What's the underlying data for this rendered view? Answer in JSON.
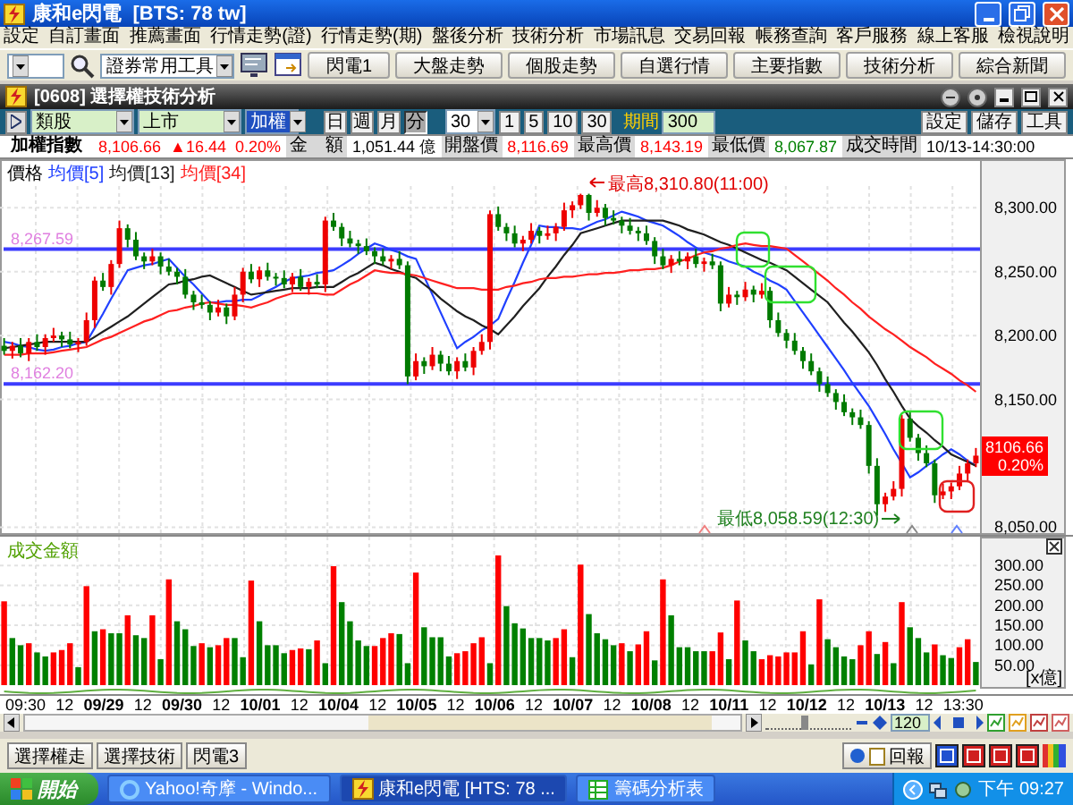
{
  "window": {
    "title": "康和e閃電  [BTS: 78 tw]"
  },
  "menu": [
    "設定",
    "自訂畫面",
    "推薦畫面",
    "行情走勢(證)",
    "行情走勢(期)",
    "盤後分析",
    "技術分析",
    "市場訊息",
    "交易回報",
    "帳務查詢",
    "客戶服務",
    "線上客服",
    "檢視說明"
  ],
  "toolbar": {
    "tool_select": "證券常用工具",
    "buttons": [
      "閃電1",
      "大盤走勢",
      "個股走勢",
      "自選行情",
      "主要指數",
      "技術分析",
      "綜合新聞"
    ]
  },
  "subwindow": {
    "title": "[0608] 選擇權技術分析"
  },
  "controls": {
    "category": "類股",
    "market": "上市",
    "symbol": "加權",
    "periods": [
      {
        "label": "日",
        "selected": false
      },
      {
        "label": "週",
        "selected": false
      },
      {
        "label": "月",
        "selected": false
      },
      {
        "label": "分",
        "selected": true
      }
    ],
    "interval": "30",
    "quick": [
      "1",
      "5",
      "10",
      "30"
    ],
    "range_label": "期間",
    "range": "300",
    "buttons": [
      "設定",
      "儲存",
      "工具"
    ]
  },
  "quote": {
    "name": "加權指數",
    "stats": [
      {
        "value": "8,106.66",
        "color": "#ff0000"
      },
      {
        "value": "▲16.44",
        "color": "#ff0000"
      },
      {
        "value": "0.20%",
        "color": "#ff0000"
      }
    ],
    "fields": [
      {
        "label": "金　額",
        "value": "1,051.44 億",
        "color": "#000000"
      },
      {
        "label": "開盤價",
        "value": "8,116.69",
        "color": "#ff0000"
      },
      {
        "label": "最高價",
        "value": "8,143.19",
        "color": "#ff0000"
      },
      {
        "label": "最低價",
        "value": "8,067.87",
        "color": "#008000"
      },
      {
        "label": "成交時間",
        "value": "10/13-14:30:00",
        "color": "#000000"
      }
    ]
  },
  "price_chart": {
    "price_label": "價格",
    "high_note": "最高8,310.80(11:00)",
    "low_note": "最低8,058.59(12:30)",
    "badge": {
      "price": "8106.66",
      "percent": "0.20%"
    },
    "chart_data": {
      "type": "candlestick",
      "grid": true,
      "ylim": [
        8044,
        8338
      ],
      "yticks": [
        {
          "value": 8300,
          "label": "8,300.00"
        },
        {
          "value": 8250,
          "label": "8,250.00"
        },
        {
          "value": 8200,
          "label": "8,200.00"
        },
        {
          "value": 8150,
          "label": "8,150.00"
        },
        {
          "value": 8050,
          "label": "8,050.00"
        }
      ],
      "ref_lines": [
        {
          "axis": "y",
          "value": 8267.59,
          "label": "8,267.59",
          "color": "#3c3cff"
        },
        {
          "axis": "y",
          "value": 8162.2,
          "label": "8,162.20",
          "color": "#3c3cff"
        }
      ],
      "ohlc": [
        [
          8192,
          8198,
          8185,
          8188
        ],
        [
          8188,
          8195,
          8182,
          8192
        ],
        [
          8192,
          8198,
          8183,
          8186
        ],
        [
          8186,
          8198,
          8180,
          8195
        ],
        [
          8195,
          8201,
          8188,
          8191
        ],
        [
          8191,
          8201,
          8185,
          8198
        ],
        [
          8198,
          8206,
          8195,
          8200
        ],
        [
          8200,
          8203,
          8191,
          8197
        ],
        [
          8197,
          8203,
          8190,
          8193
        ],
        [
          8193,
          8198,
          8187,
          8195
        ],
        [
          8195,
          8218,
          8192,
          8212
        ],
        [
          8212,
          8246,
          8206,
          8243
        ],
        [
          8243,
          8249,
          8235,
          8238
        ],
        [
          8238,
          8259,
          8232,
          8256
        ],
        [
          8256,
          8290,
          8253,
          8284
        ],
        [
          8284,
          8287,
          8269,
          8275
        ],
        [
          8275,
          8281,
          8259,
          8262
        ],
        [
          8262,
          8265,
          8252,
          8258
        ],
        [
          8258,
          8268,
          8255,
          8262
        ],
        [
          8262,
          8265,
          8248,
          8254
        ],
        [
          8254,
          8260,
          8247,
          8250
        ],
        [
          8250,
          8253,
          8240,
          8246
        ],
        [
          8246,
          8252,
          8229,
          8232
        ],
        [
          8232,
          8235,
          8220,
          8226
        ],
        [
          8226,
          8232,
          8221,
          8224
        ],
        [
          8224,
          8227,
          8212,
          8218
        ],
        [
          8218,
          8228,
          8215,
          8222
        ],
        [
          8222,
          8225,
          8209,
          8215
        ],
        [
          8215,
          8238,
          8212,
          8232
        ],
        [
          8232,
          8253,
          8226,
          8250
        ],
        [
          8250,
          8256,
          8241,
          8244
        ],
        [
          8244,
          8254,
          8238,
          8251
        ],
        [
          8251,
          8257,
          8243,
          8246
        ],
        [
          8246,
          8249,
          8239,
          8245
        ],
        [
          8245,
          8251,
          8237,
          8240
        ],
        [
          8240,
          8249,
          8234,
          8246
        ],
        [
          8246,
          8252,
          8235,
          8238
        ],
        [
          8238,
          8245,
          8232,
          8242
        ],
        [
          8242,
          8248,
          8237,
          8240
        ],
        [
          8240,
          8293,
          8234,
          8290
        ],
        [
          8290,
          8296,
          8282,
          8285
        ],
        [
          8285,
          8288,
          8270,
          8276
        ],
        [
          8276,
          8282,
          8269,
          8272
        ],
        [
          8272,
          8275,
          8264,
          8270
        ],
        [
          8270,
          8276,
          8263,
          8266
        ],
        [
          8266,
          8269,
          8256,
          8262
        ],
        [
          8262,
          8268,
          8255,
          8258
        ],
        [
          8258,
          8263,
          8252,
          8260
        ],
        [
          8260,
          8266,
          8252,
          8255
        ],
        [
          8255,
          8258,
          8162,
          8168
        ],
        [
          8168,
          8186,
          8165,
          8180
        ],
        [
          8180,
          8183,
          8170,
          8176
        ],
        [
          8176,
          8191,
          8173,
          8185
        ],
        [
          8185,
          8188,
          8172,
          8178
        ],
        [
          8178,
          8184,
          8169,
          8172
        ],
        [
          8172,
          8183,
          8166,
          8180
        ],
        [
          8180,
          8186,
          8172,
          8175
        ],
        [
          8175,
          8191,
          8169,
          8188
        ],
        [
          8188,
          8201,
          8185,
          8195
        ],
        [
          8195,
          8298,
          8189,
          8295
        ],
        [
          8295,
          8301,
          8282,
          8285
        ],
        [
          8285,
          8288,
          8274,
          8280
        ],
        [
          8280,
          8286,
          8269,
          8272
        ],
        [
          8272,
          8278,
          8266,
          8275
        ],
        [
          8275,
          8288,
          8272,
          8282
        ],
        [
          8282,
          8285,
          8272,
          8278
        ],
        [
          8278,
          8286,
          8275,
          8280
        ],
        [
          8280,
          8288,
          8274,
          8285
        ],
        [
          8285,
          8304,
          8282,
          8298
        ],
        [
          8298,
          8305,
          8292,
          8302
        ],
        [
          8302,
          8311,
          8299,
          8310
        ],
        [
          8310,
          8311,
          8290,
          8296
        ],
        [
          8296,
          8306,
          8293,
          8300
        ],
        [
          8300,
          8303,
          8286,
          8292
        ],
        [
          8292,
          8298,
          8287,
          8290
        ],
        [
          8290,
          8293,
          8280,
          8286
        ],
        [
          8286,
          8292,
          8279,
          8282
        ],
        [
          8282,
          8285,
          8274,
          8280
        ],
        [
          8280,
          8286,
          8271,
          8274
        ],
        [
          8274,
          8277,
          8256,
          8262
        ],
        [
          8262,
          8268,
          8252,
          8255
        ],
        [
          8255,
          8263,
          8249,
          8260
        ],
        [
          8260,
          8266,
          8255,
          8258
        ],
        [
          8258,
          8265,
          8252,
          8262
        ],
        [
          8262,
          8268,
          8253,
          8256
        ],
        [
          8256,
          8261,
          8250,
          8258
        ],
        [
          8258,
          8264,
          8252,
          8255
        ],
        [
          8255,
          8258,
          8219,
          8225
        ],
        [
          8225,
          8238,
          8222,
          8232
        ],
        [
          8232,
          8235,
          8224,
          8230
        ],
        [
          8230,
          8242,
          8227,
          8236
        ],
        [
          8236,
          8239,
          8226,
          8232
        ],
        [
          8232,
          8241,
          8229,
          8235
        ],
        [
          8235,
          8238,
          8206,
          8212
        ],
        [
          8212,
          8218,
          8199,
          8202
        ],
        [
          8202,
          8205,
          8190,
          8196
        ],
        [
          8196,
          8202,
          8185,
          8188
        ],
        [
          8188,
          8191,
          8174,
          8180
        ],
        [
          8180,
          8186,
          8169,
          8172
        ],
        [
          8172,
          8175,
          8156,
          8162
        ],
        [
          8162,
          8168,
          8152,
          8155
        ],
        [
          8155,
          8158,
          8142,
          8148
        ],
        [
          8148,
          8154,
          8137,
          8140
        ],
        [
          8140,
          8143,
          8130,
          8136
        ],
        [
          8136,
          8142,
          8127,
          8130
        ],
        [
          8130,
          8133,
          8092,
          8098
        ],
        [
          8098,
          8104,
          8059,
          8068
        ],
        [
          8068,
          8077,
          8062,
          8074
        ],
        [
          8074,
          8086,
          8071,
          8080
        ],
        [
          8080,
          8138,
          8074,
          8135
        ],
        [
          8135,
          8141,
          8117,
          8120
        ],
        [
          8120,
          8123,
          8102,
          8108
        ],
        [
          8108,
          8114,
          8097,
          8100
        ],
        [
          8100,
          8103,
          8069,
          8075
        ],
        [
          8075,
          8084,
          8072,
          8078
        ],
        [
          8078,
          8085,
          8072,
          8082
        ],
        [
          8082,
          8098,
          8079,
          8092
        ],
        [
          8092,
          8103,
          8086,
          8100
        ],
        [
          8100,
          8112,
          8097,
          8106
        ]
      ],
      "series": [
        {
          "name": "均價[5]",
          "type": "line",
          "color": "#2040ff",
          "values": [
            8195,
            8194,
            8192,
            8191,
            8189,
            8188,
            8189,
            8191,
            8192,
            8194,
            8195,
            8206,
            8217,
            8229,
            8240,
            8251,
            8253,
            8255,
            8256,
            8258,
            8260,
            8253,
            8246,
            8240,
            8233,
            8226,
            8226,
            8227,
            8227,
            8228,
            8228,
            8231,
            8235,
            8238,
            8242,
            8245,
            8246,
            8247,
            8249,
            8250,
            8251,
            8255,
            8259,
            8264,
            8268,
            8272,
            8270,
            8267,
            8265,
            8262,
            8260,
            8246,
            8232,
            8218,
            8204,
            8190,
            8195,
            8199,
            8204,
            8208,
            8213,
            8228,
            8242,
            8257,
            8271,
            8286,
            8285,
            8285,
            8284,
            8284,
            8283,
            8286,
            8289,
            8291,
            8294,
            8297,
            8295,
            8293,
            8290,
            8288,
            8286,
            8282,
            8278,
            8273,
            8269,
            8265,
            8263,
            8261,
            8258,
            8256,
            8254,
            8250,
            8247,
            8243,
            8240,
            8236,
            8227,
            8218,
            8209,
            8200,
            8191,
            8182,
            8173,
            8163,
            8154,
            8145,
            8134,
            8123,
            8111,
            8100,
            8089,
            8093,
            8098,
            8102,
            8107,
            8111,
            8107,
            8102,
            8098
          ]
        },
        {
          "name": "均價[13]",
          "type": "line",
          "color": "#202020",
          "values": [
            8190,
            8191,
            8192,
            8193,
            8194,
            8195,
            8195,
            8195,
            8195,
            8195,
            8195,
            8199,
            8203,
            8207,
            8211,
            8215,
            8220,
            8225,
            8230,
            8235,
            8240,
            8241,
            8243,
            8244,
            8246,
            8247,
            8244,
            8241,
            8238,
            8235,
            8232,
            8233,
            8234,
            8235,
            8236,
            8237,
            8237,
            8237,
            8238,
            8238,
            8238,
            8242,
            8246,
            8249,
            8253,
            8257,
            8255,
            8252,
            8250,
            8247,
            8245,
            8240,
            8235,
            8229,
            8224,
            8219,
            8215,
            8212,
            8208,
            8205,
            8201,
            8208,
            8215,
            8223,
            8230,
            8237,
            8246,
            8254,
            8263,
            8271,
            8280,
            8282,
            8284,
            8286,
            8288,
            8290,
            8290,
            8290,
            8290,
            8290,
            8290,
            8288,
            8286,
            8283,
            8281,
            8279,
            8276,
            8273,
            8271,
            8268,
            8265,
            8262,
            8259,
            8257,
            8254,
            8251,
            8246,
            8241,
            8236,
            8231,
            8226,
            8218,
            8210,
            8203,
            8195,
            8187,
            8177,
            8166,
            8156,
            8145,
            8135,
            8129,
            8124,
            8118,
            8113,
            8107,
            8104,
            8101,
            8098
          ]
        },
        {
          "name": "均價[34]",
          "type": "line",
          "color": "#ff2020",
          "values": [
            8185,
            8185,
            8185,
            8186,
            8186,
            8186,
            8187,
            8188,
            8189,
            8190,
            8191,
            8194,
            8197,
            8199,
            8202,
            8205,
            8208,
            8211,
            8213,
            8216,
            8219,
            8220,
            8222,
            8223,
            8225,
            8226,
            8225,
            8224,
            8224,
            8223,
            8222,
            8224,
            8226,
            8229,
            8231,
            8233,
            8233,
            8233,
            8233,
            8232,
            8232,
            8236,
            8240,
            8243,
            8247,
            8251,
            8250,
            8249,
            8249,
            8248,
            8247,
            8245,
            8243,
            8241,
            8239,
            8237,
            8237,
            8237,
            8236,
            8236,
            8236,
            8238,
            8239,
            8241,
            8242,
            8244,
            8245,
            8245,
            8246,
            8246,
            8247,
            8248,
            8248,
            8249,
            8249,
            8250,
            8251,
            8251,
            8252,
            8252,
            8253,
            8255,
            8258,
            8260,
            8263,
            8265,
            8266,
            8268,
            8269,
            8271,
            8272,
            8271,
            8270,
            8270,
            8269,
            8268,
            8263,
            8258,
            8253,
            8248,
            8243,
            8237,
            8232,
            8226,
            8221,
            8215,
            8210,
            8205,
            8201,
            8196,
            8191,
            8187,
            8183,
            8178,
            8174,
            8170,
            8165,
            8161,
            8156
          ]
        }
      ]
    }
  },
  "volume_chart": {
    "unit": "[x億]",
    "chart_data": {
      "type": "bar",
      "title": "成交金額",
      "grid": true,
      "ylim": [
        0,
        372
      ],
      "yticks": [
        {
          "value": 50,
          "label": "50.00"
        },
        {
          "value": 100,
          "label": "100.00"
        },
        {
          "value": 150,
          "label": "150.00"
        },
        {
          "value": 200,
          "label": "200.00"
        },
        {
          "value": 250,
          "label": "250.00"
        },
        {
          "value": 300,
          "label": "300.00"
        }
      ],
      "series": [
        {
          "color": "#ff0000",
          "values": [
            210,
            null,
            null,
            105,
            null,
            null,
            82,
            88,
            105,
            null,
            248,
            null,
            140,
            null,
            null,
            175,
            null,
            null,
            175,
            null,
            265,
            null,
            null,
            null,
            105,
            null,
            100,
            118,
            null,
            null,
            262,
            null,
            null,
            null,
            null,
            88,
            92,
            null,
            112,
            null,
            298,
            null,
            null,
            null,
            null,
            98,
            118,
            130,
            null,
            null,
            282,
            null,
            null,
            null,
            null,
            80,
            85,
            105,
            120,
            null,
            325,
            null,
            null,
            null,
            null,
            null,
            null,
            118,
            140,
            null,
            302,
            null,
            null,
            null,
            null,
            105,
            null,
            102,
            135,
            null,
            265,
            null,
            null,
            null,
            null,
            null,
            85,
            132,
            null,
            212,
            null,
            null,
            65,
            75,
            72,
            82,
            82,
            135,
            null,
            215,
            null,
            null,
            null,
            null,
            100,
            135,
            null,
            108,
            null,
            208,
            null,
            null,
            null,
            102,
            null,
            null,
            95,
            115,
            null
          ]
        },
        {
          "color": "#008000",
          "values": [
            null,
            118,
            100,
            null,
            82,
            72,
            null,
            null,
            null,
            45,
            null,
            135,
            null,
            130,
            130,
            null,
            125,
            118,
            null,
            65,
            null,
            160,
            140,
            98,
            null,
            95,
            null,
            null,
            118,
            70,
            null,
            160,
            100,
            100,
            80,
            null,
            null,
            90,
            null,
            55,
            null,
            208,
            160,
            112,
            98,
            null,
            null,
            null,
            128,
            55,
            null,
            145,
            120,
            120,
            72,
            null,
            null,
            null,
            null,
            55,
            null,
            198,
            155,
            142,
            118,
            118,
            112,
            null,
            null,
            70,
            null,
            178,
            130,
            115,
            100,
            null,
            85,
            null,
            null,
            62,
            null,
            175,
            95,
            95,
            85,
            85,
            null,
            null,
            65,
            null,
            112,
            85,
            null,
            null,
            null,
            null,
            null,
            null,
            52,
            null,
            115,
            95,
            72,
            65,
            null,
            null,
            78,
            null,
            55,
            null,
            145,
            118,
            82,
            null,
            75,
            68,
            null,
            null,
            58
          ]
        }
      ]
    }
  },
  "time_axis": [
    {
      "label": "09:30",
      "kind": "time"
    },
    {
      "label": "12",
      "kind": "time"
    },
    {
      "label": "09/29",
      "kind": "date"
    },
    {
      "label": "12",
      "kind": "time"
    },
    {
      "label": "09/30",
      "kind": "date"
    },
    {
      "label": "12",
      "kind": "time"
    },
    {
      "label": "10/01",
      "kind": "date"
    },
    {
      "label": "12",
      "kind": "time"
    },
    {
      "label": "10/04",
      "kind": "date"
    },
    {
      "label": "12",
      "kind": "time"
    },
    {
      "label": "10/05",
      "kind": "date"
    },
    {
      "label": "12",
      "kind": "time"
    },
    {
      "label": "10/06",
      "kind": "date"
    },
    {
      "label": "12",
      "kind": "time"
    },
    {
      "label": "10/07",
      "kind": "date"
    },
    {
      "label": "12",
      "kind": "time"
    },
    {
      "label": "10/08",
      "kind": "date"
    },
    {
      "label": "12",
      "kind": "time"
    },
    {
      "label": "10/11",
      "kind": "date"
    },
    {
      "label": "12",
      "kind": "time"
    },
    {
      "label": "10/12",
      "kind": "date"
    },
    {
      "label": "12",
      "kind": "time"
    },
    {
      "label": "10/13",
      "kind": "date"
    },
    {
      "label": "12",
      "kind": "time"
    },
    {
      "label": "13:30",
      "kind": "time"
    }
  ],
  "scroll": {
    "zoom_slider": {
      "level": 0.45
    },
    "zoom_field": "120"
  },
  "bottom": {
    "tabs": [
      "選擇權走",
      "選擇技術",
      "閃電3"
    ],
    "report_button": "回報"
  },
  "taskbar": {
    "start": "開始",
    "tasks": [
      {
        "label": "Yahoo!奇摩 - Windo...",
        "selected": false
      },
      {
        "label": "康和e閃電  [HTS: 78 ...",
        "selected": true
      },
      {
        "label": "籌碼分析表",
        "selected": false
      }
    ],
    "clock": "下午 09:27"
  }
}
